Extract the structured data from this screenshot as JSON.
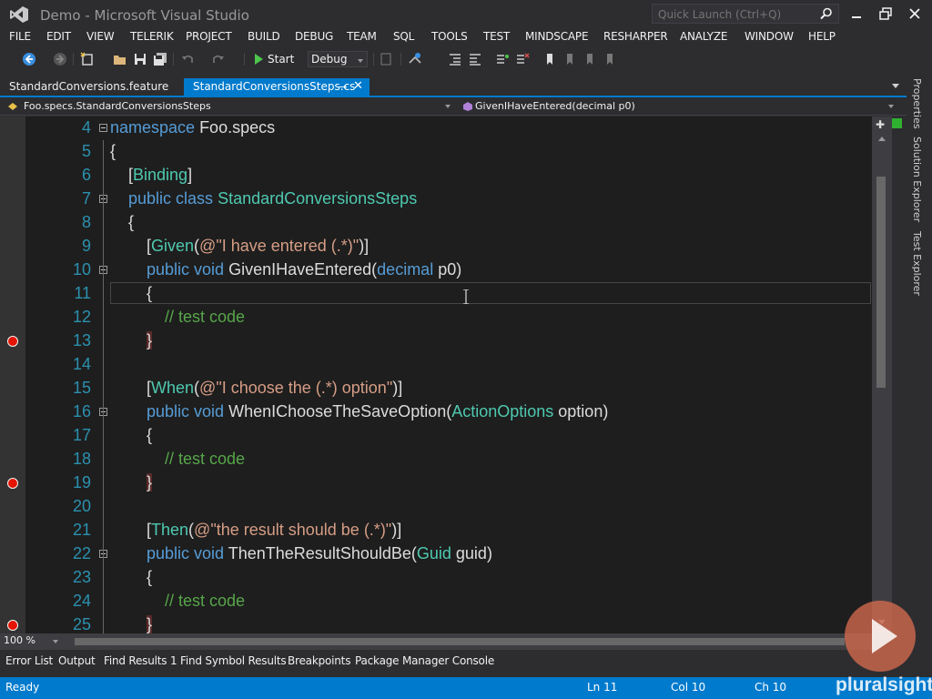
{
  "window": {
    "title": "Demo - Microsoft Visual Studio",
    "quick_launch_placeholder": "Quick Launch (Ctrl+Q)"
  },
  "menu": [
    "FILE",
    "EDIT",
    "VIEW",
    "TELERIK",
    "PROJECT",
    "BUILD",
    "DEBUG",
    "TEAM",
    "SQL",
    "TOOLS",
    "TEST",
    "MINDSCAPE",
    "RESHARPER",
    "ANALYZE",
    "WINDOW",
    "HELP"
  ],
  "toolbar": {
    "start_label": "Start",
    "configuration": "Debug"
  },
  "tabs": [
    {
      "label": "StandardConversions.feature",
      "active": false
    },
    {
      "label": "StandardConversionsSteps.cs",
      "active": true
    }
  ],
  "nav": {
    "type": "Foo.specs.StandardConversionsSteps",
    "member": "GivenIHaveEntered(decimal p0)"
  },
  "code_lines": [
    {
      "n": "4",
      "t": [
        [
          "namespace ",
          "kw"
        ],
        [
          "Foo.specs",
          ""
        ]
      ]
    },
    {
      "n": "5",
      "t": [
        [
          "{",
          ""
        ]
      ]
    },
    {
      "n": "6",
      "t": [
        [
          "    [",
          ""
        ],
        [
          "Binding",
          "ty"
        ],
        [
          "]",
          ""
        ]
      ]
    },
    {
      "n": "7",
      "t": [
        [
          "    ",
          ""
        ],
        [
          "public class ",
          "kw"
        ],
        [
          "StandardConversionsSteps",
          "ty"
        ]
      ]
    },
    {
      "n": "8",
      "t": [
        [
          "    {",
          ""
        ]
      ]
    },
    {
      "n": "9",
      "t": [
        [
          "        [",
          ""
        ],
        [
          "Given",
          "ty"
        ],
        [
          "(",
          ""
        ],
        [
          "@\"I have entered (.*)\"",
          "st"
        ],
        [
          ")]",
          ""
        ]
      ]
    },
    {
      "n": "10",
      "t": [
        [
          "        ",
          ""
        ],
        [
          "public void ",
          "kw"
        ],
        [
          "GivenIHaveEntered(",
          ""
        ],
        [
          "decimal",
          "kw"
        ],
        [
          " p0)",
          ""
        ]
      ]
    },
    {
      "n": "11",
      "t": [
        [
          "        {",
          ""
        ]
      ]
    },
    {
      "n": "12",
      "t": [
        [
          "            ",
          ""
        ],
        [
          "// test code",
          "cm"
        ]
      ]
    },
    {
      "n": "13",
      "t": [
        [
          "        }",
          ""
        ]
      ]
    },
    {
      "n": "14",
      "t": [
        [
          "",
          ""
        ]
      ]
    },
    {
      "n": "15",
      "t": [
        [
          "        [",
          ""
        ],
        [
          "When",
          "ty"
        ],
        [
          "(",
          ""
        ],
        [
          "@\"I choose the (.*) option\"",
          "st"
        ],
        [
          ")]",
          ""
        ]
      ]
    },
    {
      "n": "16",
      "t": [
        [
          "        ",
          ""
        ],
        [
          "public void ",
          "kw"
        ],
        [
          "WhenIChooseTheSaveOption(",
          ""
        ],
        [
          "ActionOptions",
          "ty"
        ],
        [
          " option)",
          ""
        ]
      ]
    },
    {
      "n": "17",
      "t": [
        [
          "        {",
          ""
        ]
      ]
    },
    {
      "n": "18",
      "t": [
        [
          "            ",
          ""
        ],
        [
          "// test code",
          "cm"
        ]
      ]
    },
    {
      "n": "19",
      "t": [
        [
          "        }",
          ""
        ]
      ]
    },
    {
      "n": "20",
      "t": [
        [
          "",
          ""
        ]
      ]
    },
    {
      "n": "21",
      "t": [
        [
          "        [",
          ""
        ],
        [
          "Then",
          "ty"
        ],
        [
          "(",
          ""
        ],
        [
          "@\"the result should be (.*)\"",
          "st"
        ],
        [
          ")]",
          ""
        ]
      ]
    },
    {
      "n": "22",
      "t": [
        [
          "        ",
          ""
        ],
        [
          "public void ",
          "kw"
        ],
        [
          "ThenTheResultShouldBe(",
          ""
        ],
        [
          "Guid",
          "ty"
        ],
        [
          " guid)",
          ""
        ]
      ]
    },
    {
      "n": "23",
      "t": [
        [
          "        {",
          ""
        ]
      ]
    },
    {
      "n": "24",
      "t": [
        [
          "            ",
          ""
        ],
        [
          "// test code",
          "cm"
        ]
      ]
    },
    {
      "n": "25",
      "t": [
        [
          "        }",
          ""
        ]
      ]
    }
  ],
  "breakpoint_lines": [
    "13",
    "19",
    "25"
  ],
  "fold_lines": [
    "4",
    "7",
    "10",
    "16",
    "22"
  ],
  "zoom": "100 %",
  "side_panels": [
    "Properties",
    "Solution Explorer",
    "Test Explorer"
  ],
  "tool_windows": [
    "Error List",
    "Output",
    "Find Results 1",
    "Find Symbol Results",
    "Breakpoints",
    "Package Manager Console"
  ],
  "status": {
    "state": "Ready",
    "ln": "Ln 11",
    "col": "Col 10",
    "ch": "Ch 10",
    "watermark": "pluralsight"
  },
  "colors": {
    "accent": "#007acc",
    "keyword": "#569cd6",
    "type": "#4ec9b0",
    "string": "#d69d85",
    "comment": "#57a64a",
    "line_number": "#2b91af",
    "breakpoint": "#e51400"
  }
}
